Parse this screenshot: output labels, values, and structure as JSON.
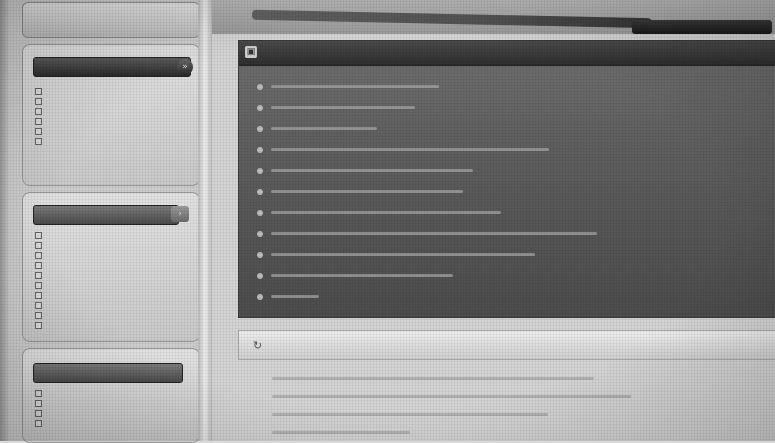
{
  "sidebar": {
    "top_box": {
      "label": ""
    },
    "panel1": {
      "title": "",
      "arrow": "»",
      "items": [
        "",
        "",
        "",
        "",
        "",
        ""
      ]
    },
    "panel2": {
      "title": "",
      "arrow": "›",
      "items": [
        "",
        "",
        "",
        "",
        "",
        "",
        "",
        "",
        "",
        ""
      ]
    },
    "panel3": {
      "title": "",
      "items": [
        "",
        "",
        "",
        ""
      ]
    }
  },
  "top_strip": {
    "corner": ""
  },
  "content": {
    "title": "",
    "icon": "window-icon",
    "items": [
      {
        "text": "",
        "w": 0.35
      },
      {
        "text": "",
        "w": 0.3
      },
      {
        "text": "",
        "w": 0.22
      },
      {
        "text": "",
        "w": 0.58
      },
      {
        "text": "",
        "w": 0.42
      },
      {
        "text": "",
        "w": 0.4
      },
      {
        "text": "",
        "w": 0.48
      },
      {
        "text": "",
        "w": 0.68
      },
      {
        "text": "",
        "w": 0.55
      },
      {
        "text": "",
        "w": 0.38
      },
      {
        "text": "",
        "w": 0.1
      }
    ]
  },
  "section": {
    "title": "",
    "icon": "refresh-icon",
    "more": ""
  },
  "news": {
    "items": [
      {
        "text": "",
        "w": 0.7
      },
      {
        "text": "",
        "w": 0.78
      },
      {
        "text": "",
        "w": 0.6
      },
      {
        "text": "",
        "w": 0.3
      }
    ]
  }
}
